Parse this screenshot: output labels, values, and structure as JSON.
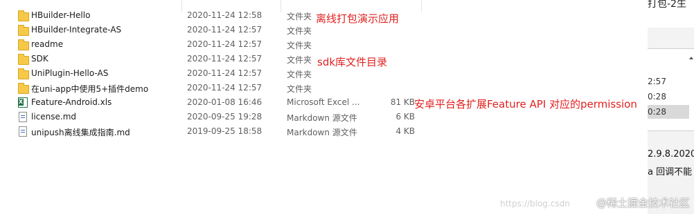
{
  "files": [
    {
      "name": "HBuilder-Hello",
      "date": "2020-11-24 12:58",
      "type": "文件夹",
      "size": "",
      "kind": "folder-icon"
    },
    {
      "name": "HBuilder-Integrate-AS",
      "date": "2020-11-24 12:57",
      "type": "文件夹",
      "size": "",
      "kind": "folder-icon"
    },
    {
      "name": "readme",
      "date": "2020-11-24 12:57",
      "type": "文件夹",
      "size": "",
      "kind": "folder-icon"
    },
    {
      "name": "SDK",
      "date": "2020-11-24 12:57",
      "type": "文件夹",
      "size": "",
      "kind": "folder-icon"
    },
    {
      "name": "UniPlugin-Hello-AS",
      "date": "2020-11-24 12:57",
      "type": "文件夹",
      "size": "",
      "kind": "folder-icon"
    },
    {
      "name": "在uni-app中使用5+插件demo",
      "date": "2020-11-24 12:57",
      "type": "文件夹",
      "size": "",
      "kind": "folder-icon"
    },
    {
      "name": "Feature-Android.xls",
      "date": "2020-01-08 16:46",
      "type": "Microsoft Excel ...",
      "size": "81 KB",
      "kind": "excel-icon"
    },
    {
      "name": "license.md",
      "date": "2020-09-25 19:28",
      "type": "Markdown 源文件",
      "size": "6 KB",
      "kind": "document-icon"
    },
    {
      "name": "unipush离线集成指南.md",
      "date": "2019-09-25 18:58",
      "type": "Markdown 源文件",
      "size": "4 KB",
      "kind": "document-icon"
    }
  ],
  "annotations": {
    "offline_demo": "离线打包演示应用",
    "sdk_dir": "sdk库文件目录",
    "feature_permission": "安卓平台各扩展Feature API 对应的permission"
  },
  "right_pane": {
    "top_text": "打包-2生",
    "times": [
      "2:57",
      "0:28",
      "0:28"
    ],
    "line1": "2.9.8.2020",
    "line2": "a 回调不能"
  },
  "watermark": {
    "url": "https://blog.csdn",
    "brand": "@稀土掘金技术社区"
  },
  "colors": {
    "annotation": "#e0201e",
    "folder": "#f7c948",
    "excel": "#1e7145"
  }
}
